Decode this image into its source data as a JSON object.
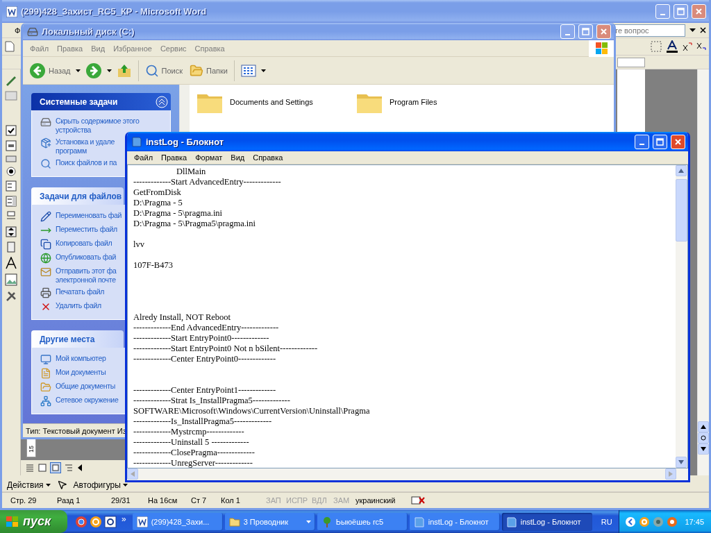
{
  "word": {
    "title": "(299)428_Захист_RC5_КР - Microsoft Word",
    "active": false,
    "menu_fragment": "Ф",
    "help_box": {
      "placeholder": "те вопрос"
    },
    "vertical_ruler_label": "15",
    "drawing_toolbar": [
      {
        "label": "Действия",
        "kind": "menu"
      },
      {
        "kind": "pointer"
      },
      {
        "label": "Автофигуры",
        "kind": "menu"
      }
    ],
    "status_bar": [
      {
        "text": "Стр. 29",
        "disabled": false
      },
      {
        "text": "Разд 1",
        "disabled": false
      },
      {
        "text": "29/31",
        "disabled": false
      },
      {
        "text": "На 16см",
        "disabled": false
      },
      {
        "text": "Ст 7",
        "disabled": false
      },
      {
        "text": "Кол 1",
        "disabled": false
      },
      {
        "text": "ЗАП",
        "disabled": true
      },
      {
        "text": "ИСПР",
        "disabled": true
      },
      {
        "text": "ВДЛ",
        "disabled": true
      },
      {
        "text": "ЗАМ",
        "disabled": true
      },
      {
        "text": "украинский",
        "disabled": false
      }
    ]
  },
  "explorer": {
    "title": "Локальный диск (C:)",
    "active": false,
    "menu": [
      "Файл",
      "Правка",
      "Вид",
      "Избранное",
      "Сервис",
      "Справка"
    ],
    "toolbar": [
      {
        "kind": "back",
        "label": "Назад"
      },
      {
        "kind": "forward"
      },
      {
        "kind": "up"
      },
      {
        "kind": "search",
        "label": "Поиск"
      },
      {
        "kind": "folders",
        "label": "Папки"
      },
      {
        "kind": "views"
      }
    ],
    "panels": [
      {
        "title": "Системные задачи",
        "highlighted": true,
        "items": [
          "Скрыть содержимое этого\nустройства",
          "Установка и удале\nпрограмм",
          "Поиск файлов и па"
        ]
      },
      {
        "title": "Задачи для файлов",
        "highlighted": false,
        "items": [
          "Переименовать фай",
          "Переместить файл",
          "Копировать файл",
          "Опубликовать фай",
          "Отправить этот фа\nэлектронной почте",
          "Печатать файл",
          "Удалить файл"
        ]
      },
      {
        "title": "Другие места",
        "highlighted": false,
        "items": [
          "Мой компьютер",
          "Мои документы",
          "Общие документы",
          "Сетевое окружение"
        ]
      }
    ],
    "files": [
      "Documents and Settings",
      "Program Files"
    ],
    "status": "Тип: Текстовый документ Из"
  },
  "notepad": {
    "title": "instLog - Блокнот",
    "active": true,
    "menu": [
      "Файл",
      "Правка",
      "Формат",
      "Вид",
      "Справка"
    ],
    "text": "\tDllMain\n-------------Start AdvancedEntry-------------\nGetFromDisk\nD:\\Pragma - 5\nD:\\Pragma - 5\\pragma.ini\nD:\\Pragma - 5\\Pragma5\\pragma.ini\n\nlvv\n\n107F-B473\n\n\n\n\nAlredy Install, NOT Reboot\n-------------End AdvancedEntry-------------\n-------------Start EntryPoint0-------------\n-------------Start EntryPoint0 Not n bSilent-------------\n-------------Center EntryPoint0-------------\n\n\n-------------Center EntryPoint1-------------\n-------------Strat Is_InstallPragma5-------------\nSOFTWARE\\Microsoft\\Windows\\CurrentVersion\\Uninstall\\Pragma\n-------------Is_InstallPragma5-------------\n-------------Mystrcmp-------------\n-------------Uninstall 5 -------------\n-------------ClosePragma-------------\n-------------UnregServer-------------"
  },
  "taskbar": {
    "start": "пуск",
    "more": "»",
    "buttons": [
      {
        "label": "(299)428_Захи...",
        "kind": "word",
        "has_menu": false,
        "selected": false
      },
      {
        "label": "3 Проводник",
        "kind": "folder",
        "has_menu": true,
        "selected": false
      },
      {
        "label": "Ьыюёшеь rc5",
        "kind": "app",
        "has_menu": false,
        "selected": false
      },
      {
        "label": "instLog - Блокнот",
        "kind": "notepad",
        "has_menu": false,
        "selected": false
      },
      {
        "label": "instLog - Блокнот",
        "kind": "notepad",
        "has_menu": false,
        "selected": true
      }
    ],
    "language": "RU",
    "clock": "17:45"
  }
}
